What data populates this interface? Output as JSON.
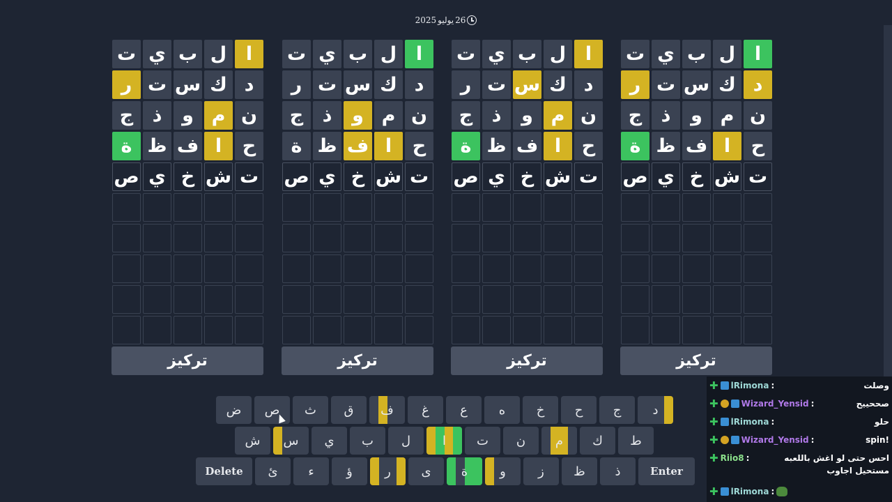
{
  "date": {
    "day": "26",
    "month": "يوليو",
    "year": "2025"
  },
  "focus_label": "تركيز",
  "boards": [
    {
      "rows": [
        [
          [
            "ا",
            "green"
          ],
          [
            "ل",
            "gray"
          ],
          [
            "ب",
            "gray"
          ],
          [
            "ي",
            "gray"
          ],
          [
            "ت",
            "gray"
          ]
        ],
        [
          [
            "د",
            "yellow"
          ],
          [
            "ك",
            "gray"
          ],
          [
            "س",
            "gray"
          ],
          [
            "ت",
            "gray"
          ],
          [
            "ر",
            "yellow"
          ]
        ],
        [
          [
            "ن",
            "gray"
          ],
          [
            "م",
            "gray"
          ],
          [
            "و",
            "gray"
          ],
          [
            "ذ",
            "gray"
          ],
          [
            "ج",
            "gray"
          ]
        ],
        [
          [
            "ح",
            "gray"
          ],
          [
            "ا",
            "yellow"
          ],
          [
            "ف",
            "gray"
          ],
          [
            "ظ",
            "gray"
          ],
          [
            "ة",
            "green"
          ]
        ],
        [
          [
            "ت",
            "typed"
          ],
          [
            "ش",
            "typed"
          ],
          [
            "خ",
            "typed"
          ],
          [
            "ي",
            "typed"
          ],
          [
            "ص",
            "typed"
          ]
        ]
      ]
    },
    {
      "rows": [
        [
          [
            "ا",
            "yellow"
          ],
          [
            "ل",
            "gray"
          ],
          [
            "ب",
            "gray"
          ],
          [
            "ي",
            "gray"
          ],
          [
            "ت",
            "gray"
          ]
        ],
        [
          [
            "د",
            "gray"
          ],
          [
            "ك",
            "gray"
          ],
          [
            "س",
            "yellow"
          ],
          [
            "ت",
            "gray"
          ],
          [
            "ر",
            "gray"
          ]
        ],
        [
          [
            "ن",
            "gray"
          ],
          [
            "م",
            "yellow"
          ],
          [
            "و",
            "gray"
          ],
          [
            "ذ",
            "gray"
          ],
          [
            "ج",
            "gray"
          ]
        ],
        [
          [
            "ح",
            "gray"
          ],
          [
            "ا",
            "yellow"
          ],
          [
            "ف",
            "gray"
          ],
          [
            "ظ",
            "gray"
          ],
          [
            "ة",
            "green"
          ]
        ],
        [
          [
            "ت",
            "typed"
          ],
          [
            "ش",
            "typed"
          ],
          [
            "خ",
            "typed"
          ],
          [
            "ي",
            "typed"
          ],
          [
            "ص",
            "typed"
          ]
        ]
      ]
    },
    {
      "rows": [
        [
          [
            "ا",
            "green"
          ],
          [
            "ل",
            "gray"
          ],
          [
            "ب",
            "gray"
          ],
          [
            "ي",
            "gray"
          ],
          [
            "ت",
            "gray"
          ]
        ],
        [
          [
            "د",
            "gray"
          ],
          [
            "ك",
            "gray"
          ],
          [
            "س",
            "gray"
          ],
          [
            "ت",
            "gray"
          ],
          [
            "ر",
            "gray"
          ]
        ],
        [
          [
            "ن",
            "gray"
          ],
          [
            "م",
            "gray"
          ],
          [
            "و",
            "yellow"
          ],
          [
            "ذ",
            "gray"
          ],
          [
            "ج",
            "gray"
          ]
        ],
        [
          [
            "ح",
            "gray"
          ],
          [
            "ا",
            "yellow"
          ],
          [
            "ف",
            "yellow"
          ],
          [
            "ظ",
            "gray"
          ],
          [
            "ة",
            "gray"
          ]
        ],
        [
          [
            "ت",
            "typed"
          ],
          [
            "ش",
            "typed"
          ],
          [
            "خ",
            "typed"
          ],
          [
            "ي",
            "typed"
          ],
          [
            "ص",
            "typed"
          ]
        ]
      ]
    },
    {
      "rows": [
        [
          [
            "ا",
            "yellow"
          ],
          [
            "ل",
            "gray"
          ],
          [
            "ب",
            "gray"
          ],
          [
            "ي",
            "gray"
          ],
          [
            "ت",
            "gray"
          ]
        ],
        [
          [
            "د",
            "gray"
          ],
          [
            "ك",
            "gray"
          ],
          [
            "س",
            "gray"
          ],
          [
            "ت",
            "gray"
          ],
          [
            "ر",
            "yellow"
          ]
        ],
        [
          [
            "ن",
            "gray"
          ],
          [
            "م",
            "yellow"
          ],
          [
            "و",
            "gray"
          ],
          [
            "ذ",
            "gray"
          ],
          [
            "ج",
            "gray"
          ]
        ],
        [
          [
            "ح",
            "gray"
          ],
          [
            "ا",
            "yellow"
          ],
          [
            "ف",
            "gray"
          ],
          [
            "ظ",
            "gray"
          ],
          [
            "ة",
            "green"
          ]
        ],
        [
          [
            "ت",
            "typed"
          ],
          [
            "ش",
            "typed"
          ],
          [
            "خ",
            "typed"
          ],
          [
            "ي",
            "typed"
          ],
          [
            "ص",
            "typed"
          ]
        ]
      ]
    }
  ],
  "keyboard": {
    "row1": [
      {
        "label": "د",
        "board_status": [
          "yellow",
          "",
          "",
          ""
        ]
      },
      {
        "label": "ج"
      },
      {
        "label": "ح"
      },
      {
        "label": "خ"
      },
      {
        "label": "ه"
      },
      {
        "label": "ع"
      },
      {
        "label": "غ"
      },
      {
        "label": "ف",
        "board_status": [
          "",
          "",
          "yellow",
          ""
        ]
      },
      {
        "label": "ق"
      },
      {
        "label": "ث"
      },
      {
        "label": "ص"
      },
      {
        "label": "ض"
      }
    ],
    "row2": [
      {
        "label": "ط"
      },
      {
        "label": "ك"
      },
      {
        "label": "م",
        "board_status": [
          "",
          "yellow",
          "yellow",
          ""
        ]
      },
      {
        "label": "ن"
      },
      {
        "label": "ت"
      },
      {
        "label": "ا",
        "board_status": [
          "green",
          "yellow",
          "green",
          "yellow"
        ]
      },
      {
        "label": "ل"
      },
      {
        "label": "ب"
      },
      {
        "label": "ي"
      },
      {
        "label": "س",
        "board_status": [
          "",
          "",
          "",
          "yellow"
        ]
      },
      {
        "label": "ش"
      }
    ],
    "row3": [
      {
        "label": "Enter",
        "wide": true
      },
      {
        "label": "ذ"
      },
      {
        "label": "ظ"
      },
      {
        "label": "ز"
      },
      {
        "label": "و",
        "board_status": [
          "",
          "",
          "",
          "yellow"
        ]
      },
      {
        "label": "ة",
        "board_status": [
          "green",
          "green",
          "",
          "green"
        ]
      },
      {
        "label": "ى"
      },
      {
        "label": "ر",
        "board_status": [
          "yellow",
          "",
          "",
          "yellow"
        ]
      },
      {
        "label": "ؤ"
      },
      {
        "label": "ء"
      },
      {
        "label": "ئ"
      },
      {
        "label": "Delete",
        "wide": true
      }
    ]
  },
  "chat": [
    {
      "user": "lRimona",
      "color": "teal",
      "badges": [
        "sub"
      ],
      "text": "وصلت"
    },
    {
      "user": "Wizard_Yensid",
      "color": "purple",
      "badges": [
        "sub",
        "bits"
      ],
      "text": "صححييح"
    },
    {
      "user": "lRimona",
      "color": "teal",
      "badges": [
        "sub"
      ],
      "text": "حلو"
    },
    {
      "user": "Wizard_Yensid",
      "color": "purple",
      "badges": [
        "sub",
        "bits"
      ],
      "text": "!spin"
    },
    {
      "user": "Riio8",
      "color": "green",
      "badges": [],
      "text": "احس حتى لو اغش باللعبه مستحيل اجاوب"
    },
    {
      "user": "lRimona",
      "color": "teal",
      "badges": [
        "sub"
      ],
      "text": "",
      "emote": "pepe-emote"
    }
  ]
}
